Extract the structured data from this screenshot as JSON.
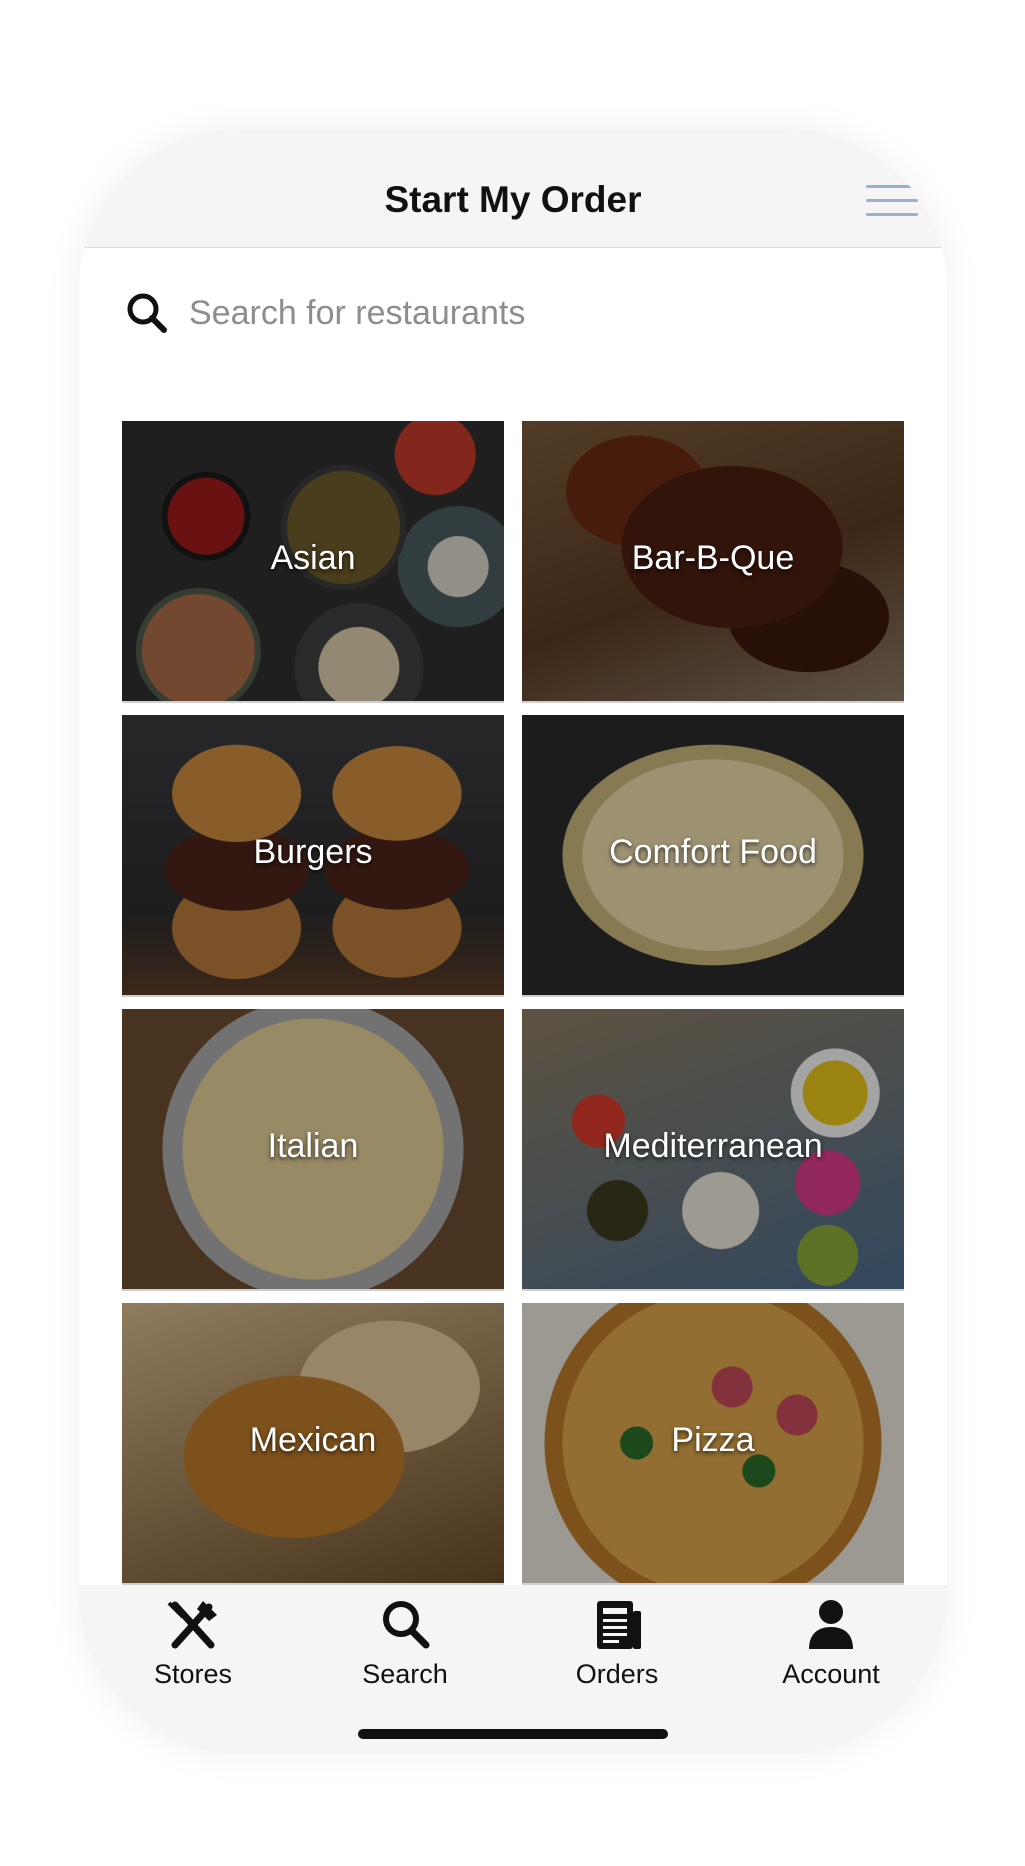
{
  "header": {
    "title": "Start My Order",
    "menu_icon": "hamburger-menu-icon"
  },
  "search": {
    "placeholder": "Search for restaurants",
    "value": "",
    "icon": "search-icon"
  },
  "categories": [
    {
      "label": "Asian"
    },
    {
      "label": "Bar-B-Que"
    },
    {
      "label": "Burgers"
    },
    {
      "label": "Comfort Food"
    },
    {
      "label": "Italian"
    },
    {
      "label": "Mediterranean"
    },
    {
      "label": "Mexican"
    },
    {
      "label": "Pizza"
    }
  ],
  "tabbar": {
    "items": [
      {
        "label": "Stores",
        "icon": "utensils-icon"
      },
      {
        "label": "Search",
        "icon": "search-icon"
      },
      {
        "label": "Orders",
        "icon": "newspaper-icon"
      },
      {
        "label": "Account",
        "icon": "user-icon"
      }
    ]
  },
  "colors": {
    "header_bg": "#f5f5f5",
    "menu_icon": "#9ab0cf",
    "text": "#111111",
    "placeholder": "#8d8d8d"
  }
}
